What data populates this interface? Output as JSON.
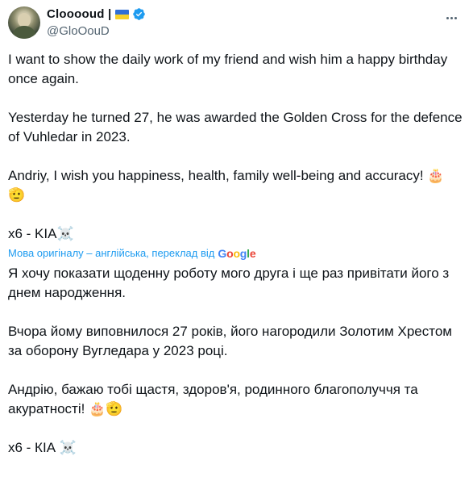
{
  "user": {
    "display_name": "Clooooud |",
    "handle": "@GloOouD",
    "flag_colors": [
      "#2f6fd6",
      "#f6d12a"
    ],
    "verified_color": "#1d9bf0"
  },
  "tweet": {
    "paragraphs": [
      "I want to show the daily work of my friend and wish him a happy birthday once again.",
      "Yesterday he turned 27, he was awarded the Golden Cross for the defence of Vuhledar in 2023.",
      "Andriy, I wish you happiness, health, family well-being and accuracy! 🎂 🫡",
      "x6 - KIA☠️"
    ]
  },
  "translation": {
    "notice": "Мова оригіналу – англійська, переклад від",
    "provider": "Google",
    "paragraphs": [
      "Я хочу показати щоденну роботу мого друга і ще раз привітати його з днем народження.",
      "Вчора йому виповнилося 27 років, його нагородили Золотим Хрестом за оборону Вугледара у 2023 році.",
      "Андрію, бажаю тобі щастя, здоров'я, родинного благополуччя та акуратності! 🎂🫡",
      "х6 - КІА ☠️"
    ]
  }
}
